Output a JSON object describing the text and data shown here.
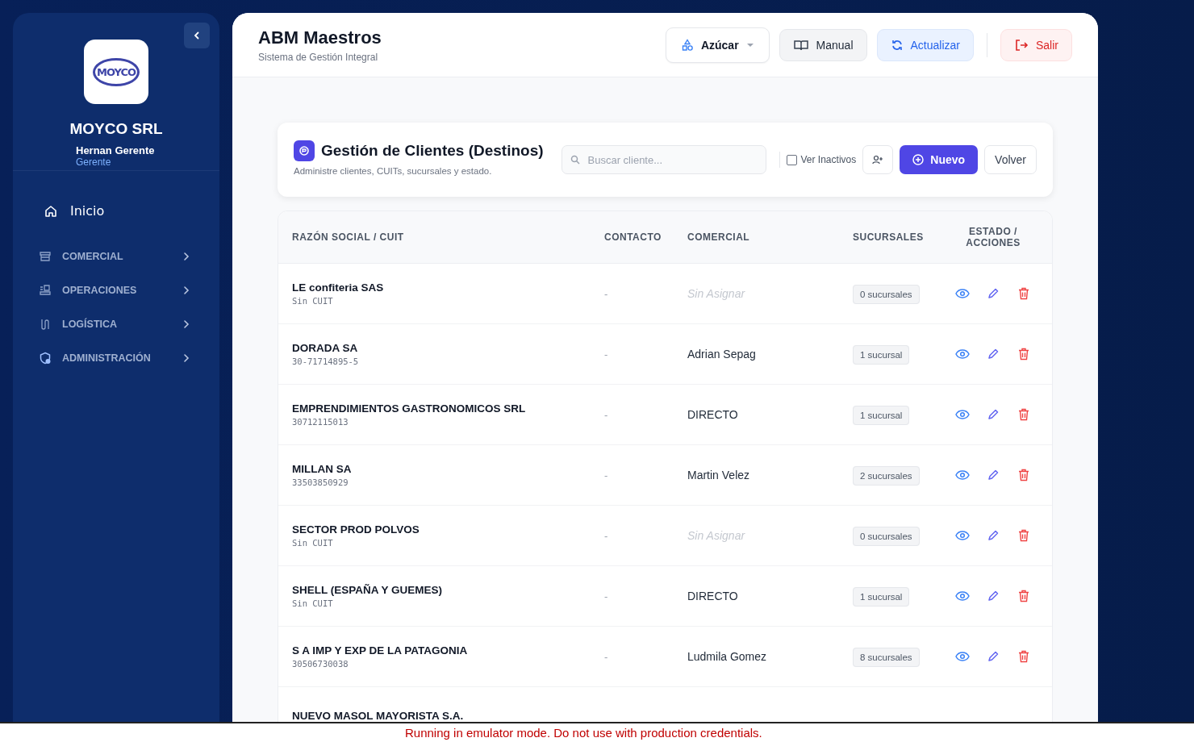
{
  "sidebar": {
    "logo": "MOYCO",
    "company": "MOYCO SRL",
    "user": "Hernan Gerente",
    "role": "Gerente",
    "items": [
      {
        "label": "Inicio",
        "kind": "link"
      },
      {
        "label": "COMERCIAL",
        "kind": "group",
        "expanded": false
      },
      {
        "label": "OPERACIONES",
        "kind": "group",
        "expanded": false
      },
      {
        "label": "LOGÍSTICA",
        "kind": "group",
        "expanded": false
      },
      {
        "label": "ADMINISTRACIÓN",
        "kind": "group",
        "expanded": false
      }
    ]
  },
  "header": {
    "title": "ABM Maestros",
    "subtitle": "Sistema de Gestión Integral",
    "buttons": [
      {
        "label": "Azúcar",
        "kind": "dropdown"
      },
      {
        "label": "Manual",
        "kind": "neutral"
      },
      {
        "label": "Actualizar",
        "kind": "soft"
      },
      {
        "label": "Salir",
        "kind": "danger"
      }
    ]
  },
  "card": {
    "title": "Gestión de Clientes (Destinos)",
    "subtitle": "Administre clientes, CUITs, sucursales y estado.",
    "search": {
      "placeholder": "Buscar cliente..."
    },
    "show_inactive": {
      "label": "Ver Inactivos",
      "checked": false
    },
    "new_button": "Nuevo",
    "back_button": "Volver"
  },
  "table": {
    "columns": [
      "RAZÓN SOCIAL / CUIT",
      "CONTACTO",
      "COMERCIAL",
      "SUCURSALES",
      "ESTADO / ACCIONES"
    ],
    "rows": [
      {
        "name": "LE confiteria SAS",
        "cuit": "Sin CUIT",
        "contact": "-",
        "commercial": "Sin Asignar",
        "assigned": false,
        "branches": "0 sucursales"
      },
      {
        "name": "DORADA SA",
        "cuit": "30-71714895-5",
        "contact": "-",
        "commercial": "Adrian Sepag",
        "assigned": true,
        "branches": "1 sucursal"
      },
      {
        "name": "EMPRENDIMIENTOS GASTRONOMICOS SRL",
        "cuit": "30712115013",
        "contact": "-",
        "commercial": "DIRECTO",
        "assigned": true,
        "branches": "1 sucursal"
      },
      {
        "name": "MILLAN SA",
        "cuit": "33503850929",
        "contact": "-",
        "commercial": "Martin Velez",
        "assigned": true,
        "branches": "2 sucursales"
      },
      {
        "name": "SECTOR PROD POLVOS",
        "cuit": "Sin CUIT",
        "contact": "-",
        "commercial": "Sin Asignar",
        "assigned": false,
        "branches": "0 sucursales"
      },
      {
        "name": "SHELL (ESPAÑA Y GUEMES)",
        "cuit": "Sin CUIT",
        "contact": "-",
        "commercial": "DIRECTO",
        "assigned": true,
        "branches": "1 sucursal"
      },
      {
        "name": "S A IMP Y EXP DE LA PATAGONIA",
        "cuit": "30506730038",
        "contact": "-",
        "commercial": "Ludmila Gomez",
        "assigned": true,
        "branches": "8 sucursales"
      },
      {
        "name": "NUEVO MASOL MAYORISTA S.A."
      }
    ]
  },
  "banner": "Running in emulator mode. Do not use with production credentials."
}
